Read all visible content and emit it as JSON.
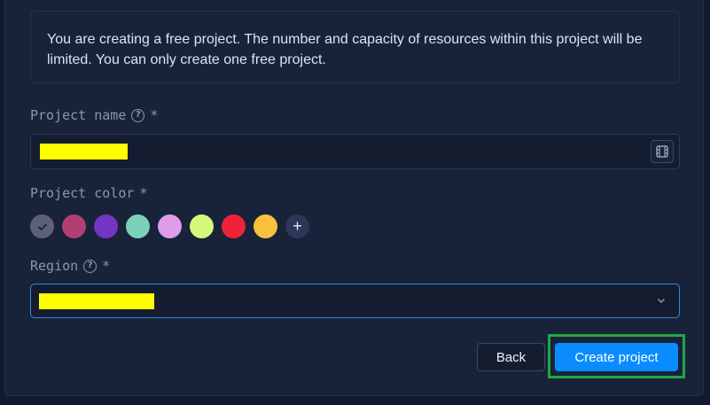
{
  "notice": {
    "text": "You are creating a free project. The number and capacity of resources within this project will be limited. You can only create one free project."
  },
  "project_name": {
    "label": "Project name",
    "required_mark": "*",
    "help_icon": "help-circle-icon",
    "value_redacted": true,
    "action_icon": "film-icon"
  },
  "project_color": {
    "label": "Project color",
    "required_mark": "*",
    "swatches": [
      {
        "color": "#5b6275",
        "selected": true
      },
      {
        "color": "#b13f73"
      },
      {
        "color": "#7236c2"
      },
      {
        "color": "#7dd1b8"
      },
      {
        "color": "#df9ce9"
      },
      {
        "color": "#d6f87a"
      },
      {
        "color": "#ee2339"
      },
      {
        "color": "#f8c03d"
      }
    ],
    "add_label": "+"
  },
  "region": {
    "label": "Region",
    "required_mark": "*",
    "help_icon": "help-circle-icon",
    "value_redacted": true,
    "dropdown_icon": "chevron-down-icon"
  },
  "actions": {
    "back_label": "Back",
    "create_label": "Create project",
    "highlight_color": "#1fa845"
  },
  "colors": {
    "accent": "#0a8cff",
    "panel_bg": "#18233a",
    "page_bg": "#111a2c"
  }
}
